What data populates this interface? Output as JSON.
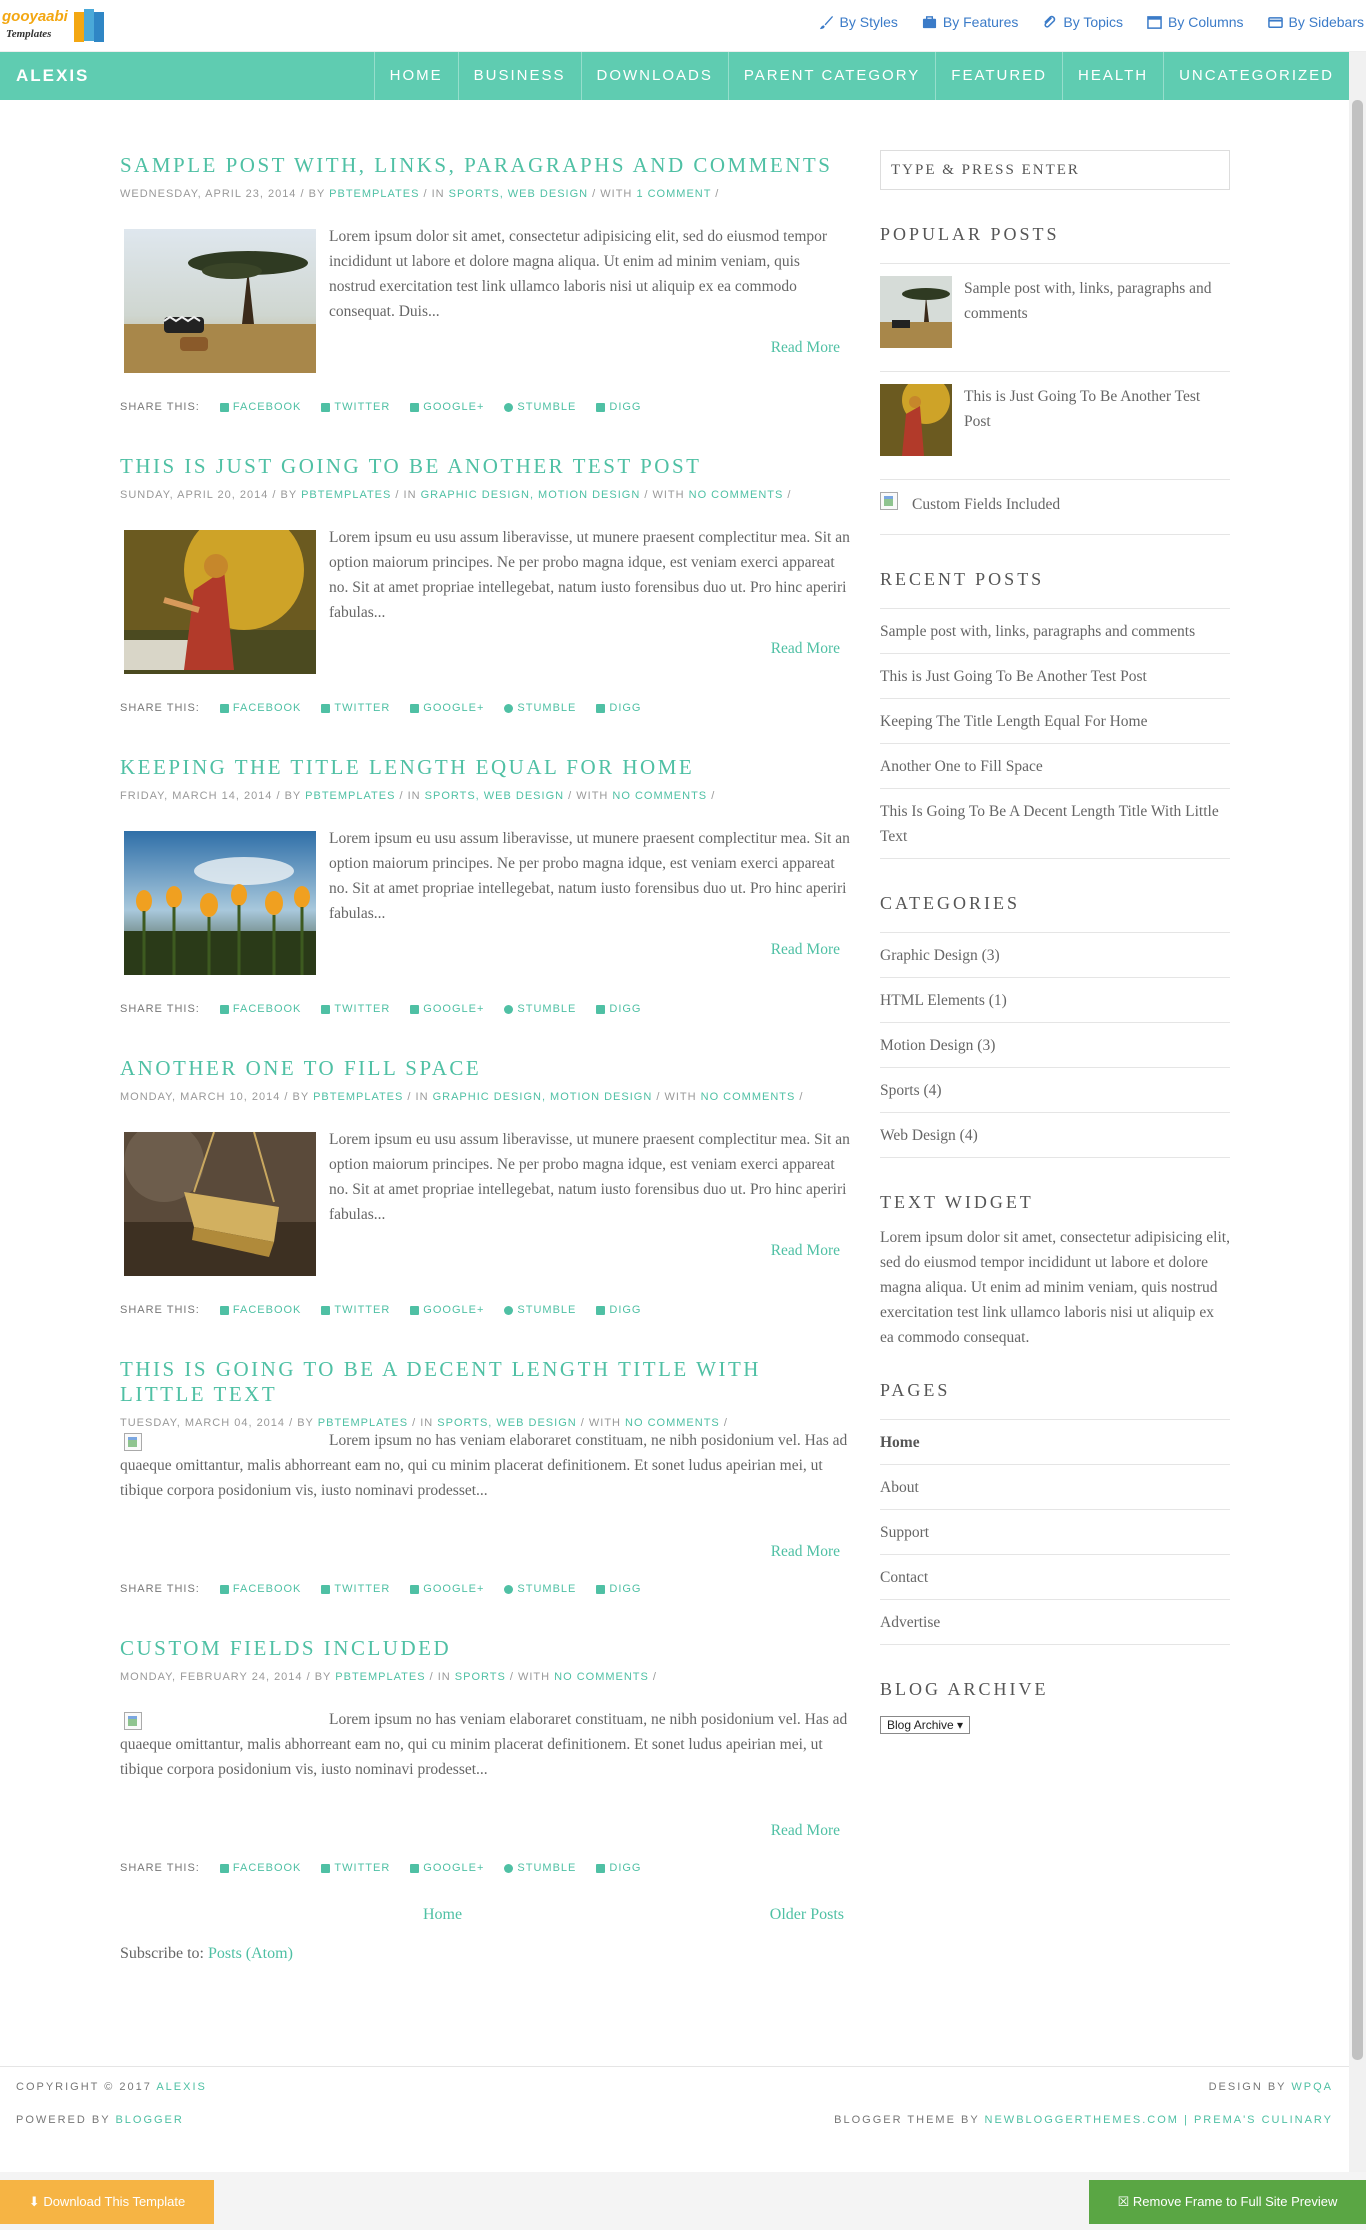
{
  "topbar": {
    "logo_line1": "gooyaabi",
    "logo_line2": "Templates",
    "links": [
      "By Styles",
      "By Features",
      "By Topics",
      "By Columns",
      "By Sidebars"
    ]
  },
  "nav": {
    "brand": "ALEXIS",
    "items": [
      "HOME",
      "BUSINESS",
      "DOWNLOADS",
      "PARENT CATEGORY",
      "FEATURED",
      "HEALTH",
      "UNCATEGORIZED"
    ]
  },
  "share": {
    "label": "SHARE THIS:",
    "items": [
      "FACEBOOK",
      "TWITTER",
      "GOOGLE+",
      "STUMBLE",
      "DIGG"
    ]
  },
  "read_more": "Read More",
  "posts": [
    {
      "title": "SAMPLE POST WITH, LINKS, PARAGRAPHS AND COMMENTS",
      "date": "WEDNESDAY, APRIL 23, 2014",
      "author": "PBTEMPLATES",
      "cats": "SPORTS, WEB DESIGN",
      "comments": "1 COMMENT",
      "excerpt": "Lorem ipsum dolor sit amet, consectetur adipisicing elit, sed do eiusmod tempor incididunt ut labore et dolore magna aliqua. Ut enim ad minim veniam, quis nostrud exercitation test link ullamco laboris nisi ut aliquip ex ea commodo consequat. Duis..."
    },
    {
      "title": "THIS IS JUST GOING TO BE ANOTHER TEST POST",
      "date": "SUNDAY, APRIL 20, 2014",
      "author": "PBTEMPLATES",
      "cats": "GRAPHIC DESIGN, MOTION DESIGN",
      "comments": "NO COMMENTS",
      "excerpt": "Lorem ipsum eu usu assum liberavisse, ut munere praesent complectitur mea. Sit an option maiorum principes. Ne per probo magna idque, est veniam exerci appareat no. Sit at amet propriae intellegebat, natum iusto forensibus duo ut. Pro hinc aperiri fabulas..."
    },
    {
      "title": "KEEPING THE TITLE LENGTH EQUAL FOR HOME",
      "date": "FRIDAY, MARCH 14, 2014",
      "author": "PBTEMPLATES",
      "cats": "SPORTS, WEB DESIGN",
      "comments": "NO COMMENTS",
      "excerpt": "Lorem ipsum eu usu assum liberavisse, ut munere praesent complectitur mea. Sit an option maiorum principes. Ne per probo magna idque, est veniam exerci appareat no. Sit at amet propriae intellegebat, natum iusto forensibus duo ut. Pro hinc aperiri fabulas..."
    },
    {
      "title": "ANOTHER ONE TO FILL SPACE",
      "date": "MONDAY, MARCH 10, 2014",
      "author": "PBTEMPLATES",
      "cats": "GRAPHIC DESIGN, MOTION DESIGN",
      "comments": "NO COMMENTS",
      "excerpt": "Lorem ipsum eu usu assum liberavisse, ut munere praesent complectitur mea. Sit an option maiorum principes. Ne per probo magna idque, est veniam exerci appareat no. Sit at amet propriae intellegebat, natum iusto forensibus duo ut. Pro hinc aperiri fabulas..."
    },
    {
      "title": "THIS IS GOING TO BE A DECENT LENGTH TITLE WITH LITTLE TEXT",
      "date": "TUESDAY, MARCH 04, 2014",
      "author": "PBTEMPLATES",
      "cats": "SPORTS, WEB DESIGN",
      "comments": "NO COMMENTS",
      "excerpt": "Lorem ipsum no has veniam elaboraret constituam, ne nibh posidonium vel. Has ad quaeque omittantur, malis abhorreant eam no, qui cu minim placerat definitionem. Et sonet ludus apeirian mei, ut tibique corpora posidonium vis, iusto nominavi prodesset..."
    },
    {
      "title": "CUSTOM FIELDS INCLUDED",
      "date": "MONDAY, FEBRUARY 24, 2014",
      "author": "PBTEMPLATES",
      "cats": "SPORTS",
      "comments": "NO COMMENTS",
      "excerpt": "Lorem ipsum no has veniam elaboraret constituam, ne nibh posidonium vel. Has ad quaeque omittantur, malis abhorreant eam no, qui cu minim placerat definitionem. Et sonet ludus apeirian mei, ut tibique corpora posidonium vis, iusto nominavi prodesset..."
    }
  ],
  "meta_words": {
    "by": "BY",
    "in": "IN",
    "with": "WITH"
  },
  "pager": {
    "home": "Home",
    "older": "Older Posts"
  },
  "subscribe": {
    "label": "Subscribe to:",
    "link": "Posts (Atom)"
  },
  "sidebar": {
    "search_placeholder": "TYPE & PRESS ENTER",
    "popular_title": "POPULAR POSTS",
    "popular": [
      "Sample post with, links, paragraphs and comments",
      "This is Just Going To Be Another Test Post",
      "Custom Fields Included"
    ],
    "recent_title": "RECENT POSTS",
    "recent": [
      "Sample post with, links, paragraphs and comments",
      "This is Just Going To Be Another Test Post",
      "Keeping The Title Length Equal For Home",
      "Another One to Fill Space",
      "This Is Going To Be A Decent Length Title With Little Text"
    ],
    "categories_title": "CATEGORIES",
    "categories": [
      "Graphic Design (3)",
      "HTML Elements (1)",
      "Motion Design (3)",
      "Sports (4)",
      "Web Design (4)"
    ],
    "text_title": "TEXT WIDGET",
    "text_body": "Lorem ipsum dolor sit amet, consectetur adipisicing elit, sed do eiusmod tempor incididunt ut labore et dolore magna aliqua. Ut enim ad minim veniam, quis nostrud exercitation test link ullamco laboris nisi ut aliquip ex ea commodo consequat.",
    "pages_title": "PAGES",
    "pages": [
      "Home",
      "About",
      "Support",
      "Contact",
      "Advertise"
    ],
    "archive_title": "BLOG ARCHIVE",
    "archive_select": "Blog Archive"
  },
  "footer": {
    "copyright": "COPYRIGHT © 2017",
    "copyright_name": "ALEXIS",
    "design_label": "DESIGN BY",
    "design_name": "WPQA",
    "powered_label": "POWERED BY",
    "powered_name": "BLOGGER",
    "theme_label": "BLOGGER THEME BY",
    "theme_name": "NEWBLOGGERTHEMES.COM",
    "theme_sep": "|",
    "theme_name2": "PREMA'S CULINARY"
  },
  "bottombar": {
    "download": "Download This Template",
    "remove_frame": "Remove Frame to Full Site Preview"
  }
}
